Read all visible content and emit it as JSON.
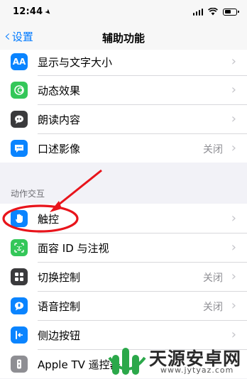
{
  "status_bar": {
    "time": "12:44"
  },
  "nav": {
    "back_label": "设置",
    "title": "辅助功能"
  },
  "vision_rows": [
    {
      "label": "显示与文字大小",
      "icon": "AA",
      "color": "#0a84ff"
    },
    {
      "label": "动态效果",
      "icon": "motion-icon",
      "color": "#34c759"
    },
    {
      "label": "朗读内容",
      "icon": "speech-icon",
      "color": "#3a3a3c"
    },
    {
      "label": "口述影像",
      "icon": "audio-description-icon",
      "color": "#0a84ff",
      "value": "关闭"
    }
  ],
  "section_header": "动作交互",
  "interaction_rows": [
    {
      "label": "触控",
      "icon": "hand-touch-icon",
      "color": "#0a84ff"
    },
    {
      "label": "面容 ID 与注视",
      "icon": "face-id-icon",
      "color": "#34c759"
    },
    {
      "label": "切换控制",
      "icon": "switch-control-icon",
      "color": "#3a3a3c",
      "value": "关闭"
    },
    {
      "label": "语音控制",
      "icon": "voice-control-icon",
      "color": "#0a84ff",
      "value": "关闭"
    },
    {
      "label": "侧边按钮",
      "icon": "side-button-icon",
      "color": "#0a84ff"
    },
    {
      "label": "Apple TV 遥控器",
      "icon": "remote-icon",
      "color": "#8e8e93"
    }
  ],
  "watermark": {
    "text": "天源安卓网",
    "url": "www.jytyaz.com"
  }
}
